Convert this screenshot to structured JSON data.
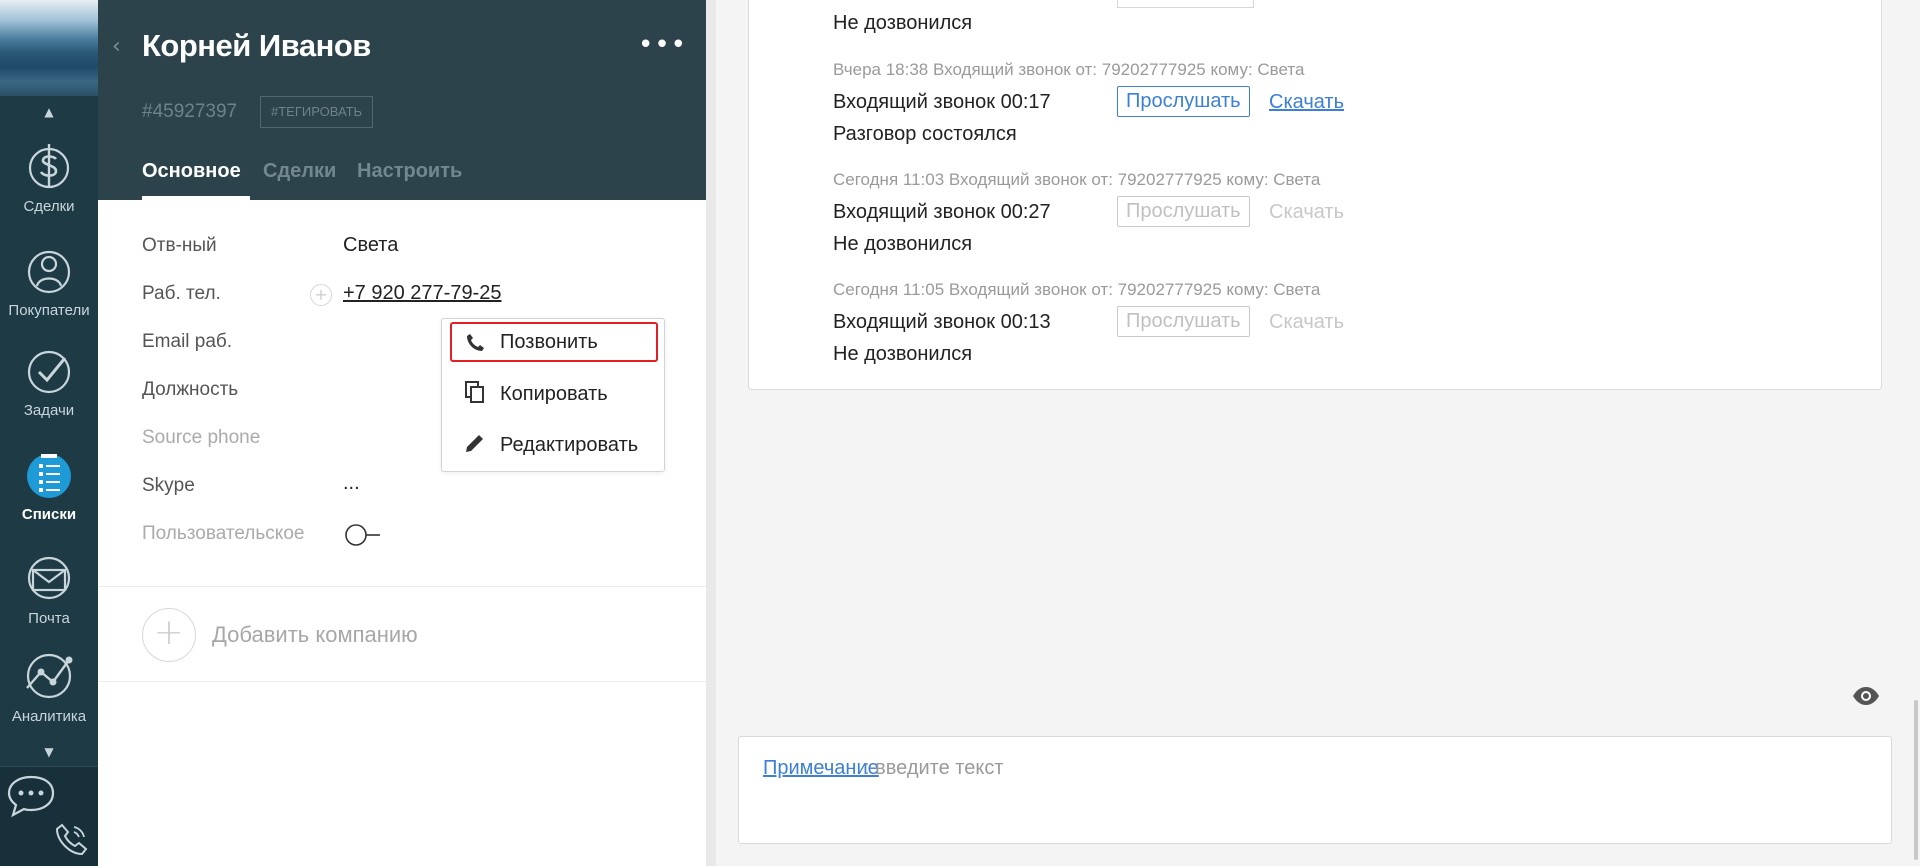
{
  "nav": {
    "items": [
      {
        "label": "Сделки",
        "icon": "dollar-icon"
      },
      {
        "label": "Покупатели",
        "icon": "customers-icon"
      },
      {
        "label": "Задачи",
        "icon": "check-icon"
      },
      {
        "label": "Списки",
        "icon": "list-icon",
        "active": true
      },
      {
        "label": "Почта",
        "icon": "mail-icon"
      },
      {
        "label": "Аналитика",
        "icon": "analytics-icon"
      }
    ],
    "up_arrow": "▲",
    "down_arrow": "▼"
  },
  "contact": {
    "back": "‹",
    "name": "Корней Иванов",
    "more": "•••",
    "id": "#45927397",
    "tag_button": "#ТЕГИРОВАТЬ",
    "tabs": [
      "Основное",
      "Сделки",
      "Настроить"
    ],
    "fields": [
      {
        "label": "Отв-ный",
        "value": "Света"
      },
      {
        "label": "Раб. тел.",
        "value": "+7 920 277-79-25"
      },
      {
        "label": "Email раб.",
        "value": ""
      },
      {
        "label": "Должность",
        "value": ""
      },
      {
        "label": "Source phone",
        "value": ""
      },
      {
        "label": "Skype",
        "value": "..."
      },
      {
        "label": "Пользовательское",
        "value": ""
      }
    ],
    "add_company": "Добавить компанию",
    "add_plus": "+"
  },
  "phone_menu": {
    "items": [
      {
        "label": "Позвонить",
        "icon": "phone-icon"
      },
      {
        "label": "Копировать",
        "icon": "copy-icon"
      },
      {
        "label": "Редактировать",
        "icon": "pencil-icon"
      }
    ]
  },
  "feed": {
    "calls": [
      {
        "meta": "",
        "line": "",
        "status": "Не дозвонился",
        "listen": "",
        "download": ""
      },
      {
        "meta": "Вчера 18:38 Входящий звонок от: 79202777925 кому: Света",
        "line": "Входящий звонок 00:17",
        "listen": "Прослушать",
        "download": "Скачать",
        "status": "Разговор состоялся",
        "active": true
      },
      {
        "meta": "Сегодня 11:03 Входящий звонок от: 79202777925 кому: Света",
        "line": "Входящий звонок 00:27",
        "listen": "Прослушать",
        "download": "Скачать",
        "status": "Не дозвонился",
        "active": false
      },
      {
        "meta": "Сегодня 11:05 Входящий звонок от: 79202777925 кому: Света",
        "line": "Входящий звонок 00:13",
        "listen": "Прослушать",
        "download": "Скачать",
        "status": "Не дозвонился",
        "active": false
      }
    ],
    "note_link": "Примечание",
    "note_placeholder": ": введите текст"
  },
  "colors": {
    "nav_bg": "#1e3a45",
    "header_bg": "#2c434c",
    "accent_blue": "#3b7fd6",
    "highlight_red": "#e31e24"
  }
}
